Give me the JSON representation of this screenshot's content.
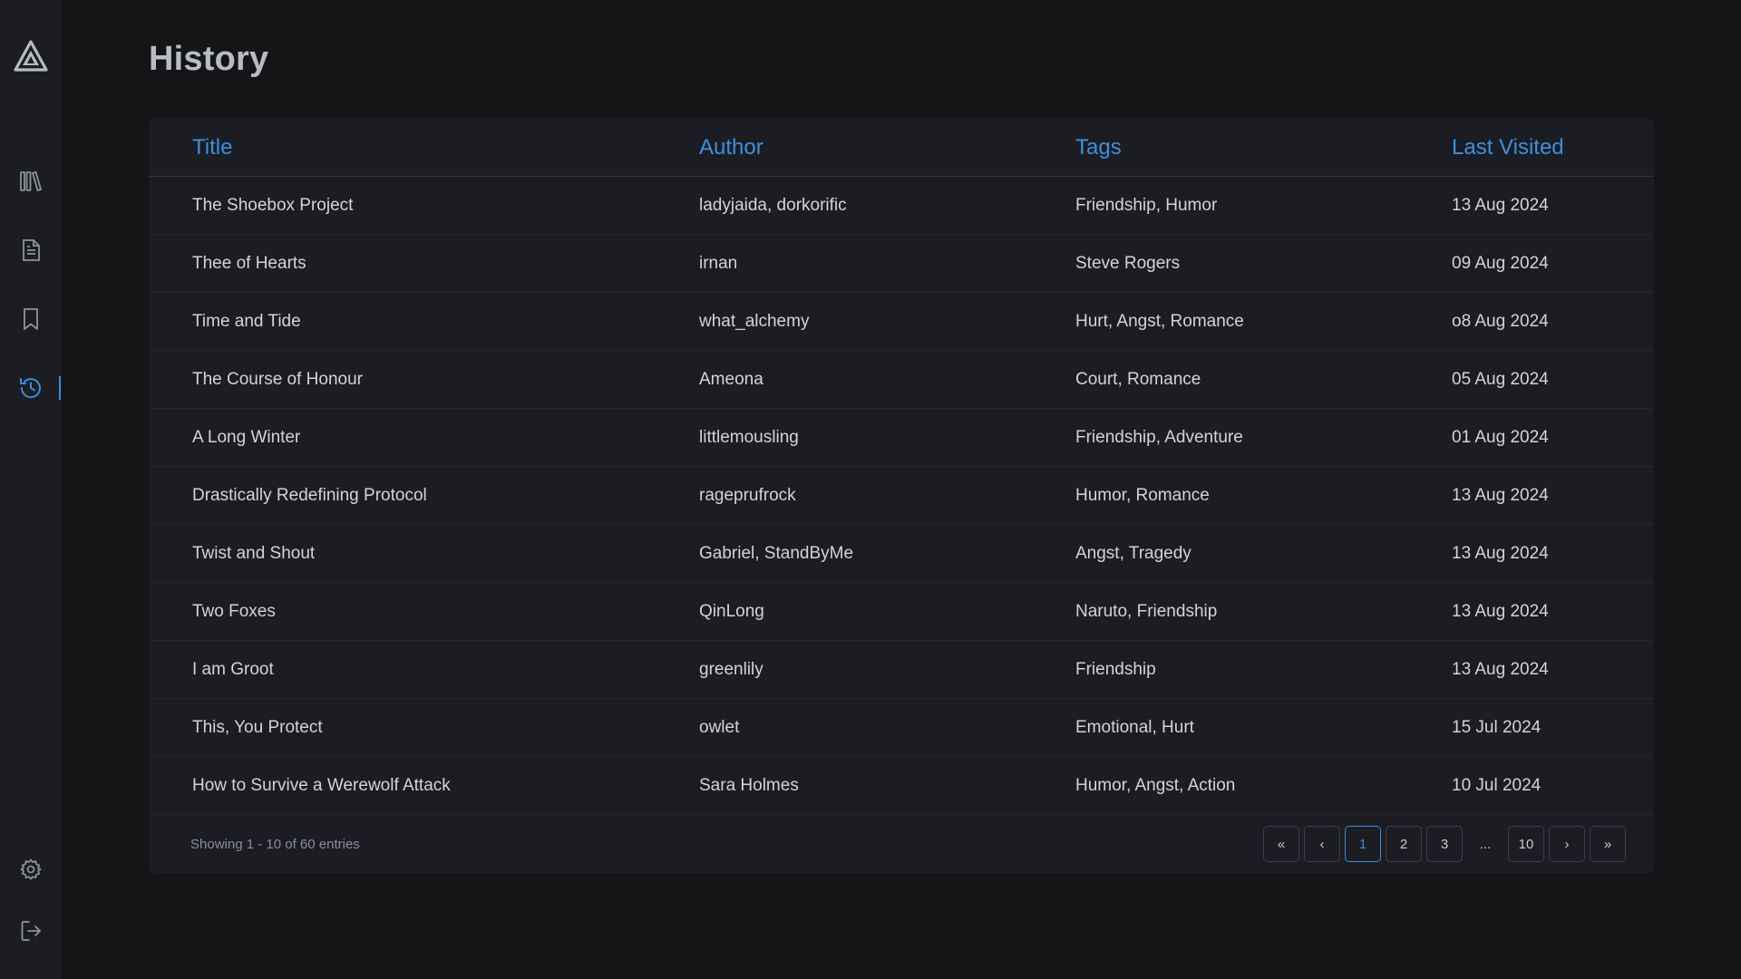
{
  "page": {
    "title": "History"
  },
  "sidebar": {
    "items": [
      {
        "icon": "library-icon"
      },
      {
        "icon": "document-icon"
      },
      {
        "icon": "bookmark-icon"
      },
      {
        "icon": "history-icon",
        "active": true
      }
    ],
    "bottom": [
      {
        "icon": "settings-icon"
      },
      {
        "icon": "logout-icon"
      }
    ]
  },
  "colors": {
    "accent": "#3a8ddc",
    "background": "#141517",
    "sidebar": "#1b1d21",
    "card": "#1b1d22"
  },
  "table": {
    "columns": [
      "Title",
      "Author",
      "Tags",
      "Last Visited"
    ],
    "rows": [
      [
        "The Shoebox Project",
        "ladyjaida, dorkorific",
        "Friendship, Humor",
        "13 Aug 2024"
      ],
      [
        "Thee of Hearts",
        "irnan",
        "Steve Rogers",
        "09 Aug 2024"
      ],
      [
        "Time and Tide",
        "what_alchemy",
        "Hurt, Angst, Romance",
        "o8 Aug 2024"
      ],
      [
        "The Course of Honour",
        "Ameona",
        "Court, Romance",
        "05 Aug 2024"
      ],
      [
        "A Long Winter",
        "littlemousling",
        "Friendship, Adventure",
        "01 Aug 2024"
      ],
      [
        "Drastically Redefining Protocol",
        "rageprufrock",
        "Humor, Romance",
        "13 Aug 2024"
      ],
      [
        "Twist and Shout",
        "Gabriel, StandByMe",
        "Angst, Tragedy",
        "13 Aug 2024"
      ],
      [
        "Two Foxes",
        "QinLong",
        "Naruto, Friendship",
        "13 Aug 2024"
      ],
      [
        "I am Groot",
        "greenlily",
        "Friendship",
        "13 Aug 2024"
      ],
      [
        "This, You Protect",
        "owlet",
        "Emotional, Hurt",
        "15 Jul 2024"
      ],
      [
        "How to Survive a Werewolf Attack",
        "Sara Holmes",
        "Humor, Angst, Action",
        "10 Jul 2024"
      ]
    ]
  },
  "pagination": {
    "summary": "Showing 1 - 10 of 60 entries",
    "first": "«",
    "prev": "‹",
    "pages": [
      "1",
      "2",
      "3"
    ],
    "ellipsis": "...",
    "last_page": "10",
    "next": "›",
    "last": "»",
    "current": "1"
  }
}
